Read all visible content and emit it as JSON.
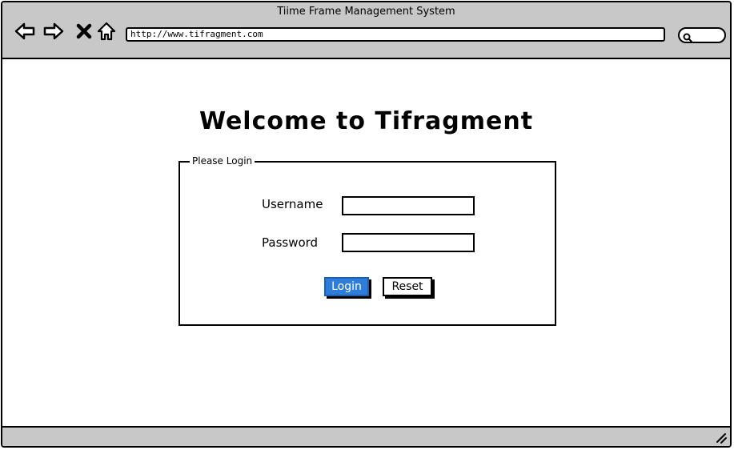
{
  "window": {
    "title": "Tiime Frame Management System"
  },
  "toolbar": {
    "back_icon": "back-arrow-icon",
    "forward_icon": "forward-arrow-icon",
    "stop_icon": "close-icon",
    "home_icon": "home-icon",
    "url": "http://www.tifragment.com",
    "search_icon": "search-icon"
  },
  "main": {
    "heading": "Welcome to Tifragment",
    "login_form": {
      "legend": "Please Login",
      "username_label": "Username",
      "username_value": "",
      "password_label": "Password",
      "password_value": "",
      "login_button": "Login",
      "reset_button": "Reset"
    }
  },
  "colors": {
    "chrome": "#c8c8c8",
    "primary_button": "#2f7ddb"
  }
}
